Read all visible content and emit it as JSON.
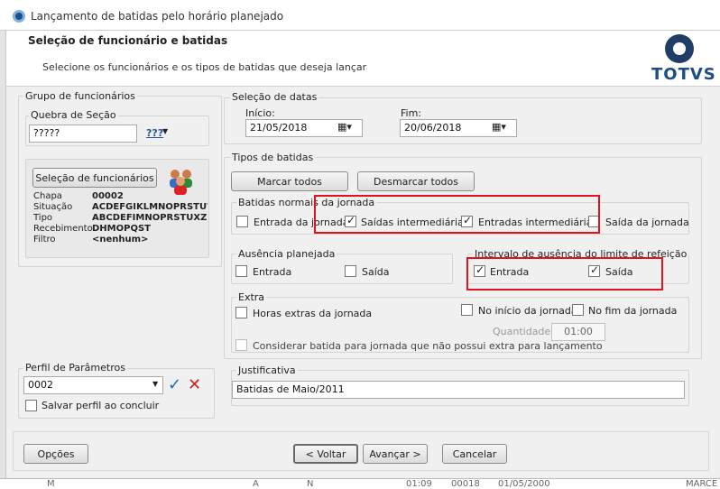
{
  "window": {
    "title": "Lançamento de batidas pelo horário planejado"
  },
  "header": {
    "title": "Seleção de funcionário e batidas",
    "subtitle": "Selecione os funcionários e os tipos de batidas que deseja lançar",
    "logo": "TOTVS",
    "accent": "#1f4e85"
  },
  "left": {
    "group_title": "Grupo de funcionários",
    "quebra_label": "Quebra de Seção",
    "quebra_value": "?????",
    "lookup": "???",
    "sel_button": "Seleção de funcionários",
    "info": [
      {
        "label": "Chapa",
        "value": "00002"
      },
      {
        "label": "Situação",
        "value": "ACDEFGIKLMNOPRSTUV"
      },
      {
        "label": "Tipo",
        "value": "ABCDEFIMNOPRSTUXZ"
      },
      {
        "label": "Recebimento",
        "value": "DHMOPQST"
      },
      {
        "label": "Filtro",
        "value": "<nenhum>"
      }
    ],
    "perfil_title": "Perfil de Parâmetros",
    "perfil_value": "0002",
    "salvar_label": "Salvar perfil ao concluir"
  },
  "datas": {
    "title": "Seleção de datas",
    "inicio_label": "Início:",
    "inicio": "21/05/2018",
    "fim_label": "Fim:",
    "fim": "20/06/2018"
  },
  "tipos": {
    "title": "Tipos de batidas",
    "marcar": "Marcar todos",
    "desmarcar": "Desmarcar todos",
    "normais_title": "Batidas normais da jornada",
    "entrada_jornada": "Entrada da jornada",
    "saidas_inter": "Saídas intermediárias",
    "entradas_inter": "Entradas intermediárias",
    "saida_jornada": "Saída da jornada",
    "ausencia_title": "Ausência planejada",
    "aus_entrada": "Entrada",
    "aus_saida": "Saída",
    "intervalo_title": "Intervalo de ausência do limite de refeição",
    "int_entrada": "Entrada",
    "int_saida": "Saída",
    "extra_title": "Extra",
    "horas_extras": "Horas extras da jornada",
    "inicio_jornada": "No início da jornada",
    "fim_jornada": "No fim da jornada",
    "quantidade_label": "Quantidade:",
    "quantidade": "01:00",
    "considerar": "Considerar batida para jornada que não possui extra para lançamento"
  },
  "justificativa": {
    "title": "Justificativa",
    "value": "Batidas de Maio/2011"
  },
  "footer": {
    "opcoes": "Opções",
    "voltar": "< Voltar",
    "avancar": "Avançar >",
    "cancelar": "Cancelar"
  },
  "background_row": [
    "M",
    "A",
    "N",
    "01:09",
    "00018",
    "01/05/2000",
    "MARCE"
  ]
}
